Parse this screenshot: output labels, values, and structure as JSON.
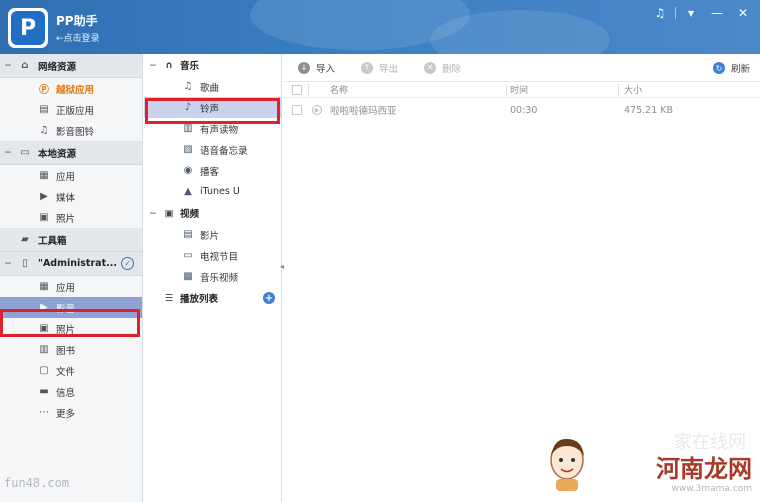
{
  "header": {
    "app_title": "PP助手",
    "login_link": "←点击登录",
    "logo_letter": "P",
    "controls": {
      "music": "♫",
      "menu": "▾",
      "minimize": "—",
      "close": "✕"
    }
  },
  "sidebar": {
    "sections": [
      {
        "label": "网络资源",
        "icon": "home-icon",
        "items": [
          {
            "label": "越狱应用",
            "icon": "pp-icon",
            "style": "orange"
          },
          {
            "label": "正版应用",
            "icon": "store-icon"
          },
          {
            "label": "影音图铃",
            "icon": "music-icon"
          }
        ]
      },
      {
        "label": "本地资源",
        "icon": "monitor-icon",
        "items": [
          {
            "label": "应用",
            "icon": "grid-icon"
          },
          {
            "label": "媒体",
            "icon": "video-icon"
          },
          {
            "label": "照片",
            "icon": "photo-icon"
          }
        ]
      },
      {
        "label": "工具箱",
        "icon": "toolbox-icon",
        "items": []
      },
      {
        "label": "\"Administrat...",
        "icon": "phone-icon",
        "items": [
          {
            "label": "应用",
            "icon": "grid-icon"
          },
          {
            "label": "影音",
            "icon": "video-icon",
            "selected": true
          },
          {
            "label": "照片",
            "icon": "photo-icon"
          },
          {
            "label": "图书",
            "icon": "book-icon"
          },
          {
            "label": "文件",
            "icon": "file-icon"
          },
          {
            "label": "信息",
            "icon": "message-icon"
          },
          {
            "label": "更多",
            "icon": "more-icon"
          }
        ]
      }
    ],
    "watermark": "fun48.com"
  },
  "tree": {
    "music_head": "音乐",
    "music_items": [
      {
        "label": "歌曲",
        "icon": "note-icon"
      },
      {
        "label": "铃声",
        "icon": "bell-icon",
        "selected": true
      },
      {
        "label": "有声读物",
        "icon": "audiobook-icon"
      },
      {
        "label": "语音备忘录",
        "icon": "voice-memo-icon"
      },
      {
        "label": "播客",
        "icon": "podcast-icon"
      },
      {
        "label": "iTunes U",
        "icon": "itunes-u-icon"
      }
    ],
    "video_head": "视频",
    "video_items": [
      {
        "label": "影片",
        "icon": "movie-icon"
      },
      {
        "label": "电视节目",
        "icon": "tv-icon"
      },
      {
        "label": "音乐视频",
        "icon": "music-video-icon"
      }
    ],
    "playlist_head": "播放列表"
  },
  "toolbar": {
    "import": "导入",
    "export": "导出",
    "delete": "删除",
    "refresh": "刷新"
  },
  "table": {
    "columns": [
      "名称",
      "时间",
      "大小"
    ],
    "rows": [
      {
        "name": "啦啦啦德玛西亚",
        "time": "00:30",
        "size": "475.21 KB"
      }
    ]
  },
  "watermark": {
    "title": "河南龙网",
    "url": "www.3mama.com",
    "faint": "家在线网"
  },
  "colors": {
    "header": "#2f6fb2",
    "selected_sidebar": "#8fa2d6",
    "selected_tree": "#c9d3ee",
    "highlight_box": "#e0202a",
    "accent": "#e07a12"
  }
}
